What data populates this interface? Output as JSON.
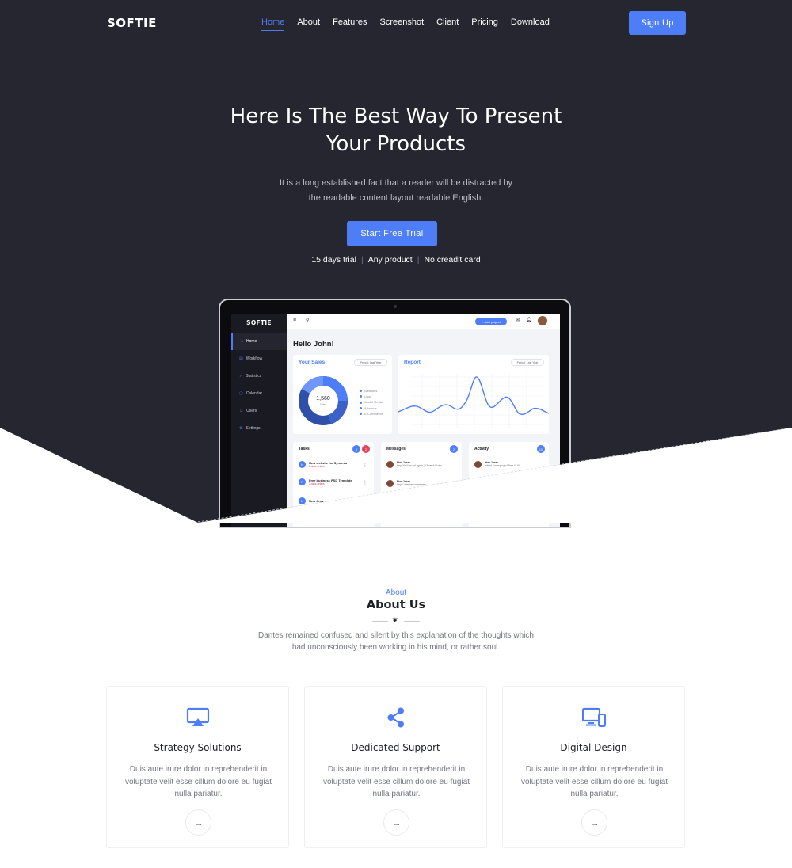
{
  "colors": {
    "hero_bg": "#262631",
    "accent": "#4d7ef7",
    "text_dark": "#1e1f27",
    "text_muted": "#747683",
    "danger": "#e2445c"
  },
  "brand": {
    "logo": "SOFTIE"
  },
  "nav": {
    "items": [
      {
        "label": "Home",
        "active": true
      },
      {
        "label": "About"
      },
      {
        "label": "Features"
      },
      {
        "label": "Screenshot"
      },
      {
        "label": "Client"
      },
      {
        "label": "Pricing"
      },
      {
        "label": "Download"
      }
    ],
    "signup_label": "Sign Up"
  },
  "hero": {
    "title_line1": "Here Is The Best Way To Present",
    "title_line2": "Your Products",
    "desc_line1": "It is a long established fact that a reader will be distracted by",
    "desc_line2": "the readable content layout readable English.",
    "cta_label": "Start Free Trial",
    "features": [
      "15 days trial",
      "Any product",
      "No creadit card"
    ]
  },
  "dashboard": {
    "logo": "SOFTIE",
    "sidebar": [
      "Home",
      "Workflow",
      "Statistics",
      "Calendar",
      "Users",
      "Settings"
    ],
    "add_project": "+ Add project",
    "greeting": "Hello John!",
    "sales": {
      "title": "Your Sales",
      "period": "Period: Last Year",
      "total": "1,560",
      "total_label": "Sales",
      "legend": [
        "Websites",
        "Logo",
        "Social Media",
        "Adwords",
        "E-Commerce"
      ]
    },
    "report": {
      "title": "Report",
      "period": "Period: Last Year"
    },
    "tasks": {
      "title": "Tasks",
      "badge1": "6",
      "badge2": "2",
      "items": [
        {
          "initial": "N",
          "title": "New website for Symu.co",
          "due": "5 days delays"
        },
        {
          "initial": "F",
          "title": "Free business PSD Template",
          "due": "2 days delays"
        },
        {
          "initial": "N",
          "title": "New Jess..."
        }
      ]
    },
    "messages": {
      "title": "Messages",
      "badge": "2",
      "items": [
        {
          "name": "Nina Jones",
          "text": "Hey! You! I'm not again :) I'll send it later"
        },
        {
          "name": "Nina Jones",
          "text": "Hey! I attached some new..."
        }
      ]
    },
    "activity": {
      "title": "Activity",
      "badge": "10",
      "items": [
        {
          "name": "Nina Jones",
          "text": "added a new project Free UI Kit"
        }
      ]
    }
  },
  "about": {
    "eyebrow": "About",
    "title": "About Us",
    "desc_line1": "Dantes remained confused and silent by this explanation of the thoughts which",
    "desc_line2": "had unconsciously been working in his mind, or rather soul.",
    "services": [
      {
        "icon": "airplay-icon",
        "title": "Strategy Solutions",
        "line1": "Duis aute irure dolor in reprehenderit in",
        "line2": "voluptate velit esse cillum dolore eu fugiat",
        "line3": "nulla pariatur."
      },
      {
        "icon": "share-icon",
        "title": "Dedicated Support",
        "line1": "Duis aute irure dolor in reprehenderit in",
        "line2": "voluptate velit esse cillum dolore eu fugiat",
        "line3": "nulla pariatur."
      },
      {
        "icon": "devices-icon",
        "title": "Digital Design",
        "line1": "Duis aute irure dolor in reprehenderit in",
        "line2": "voluptate velit esse cillum dolore eu fugiat",
        "line3": "nulla pariatur."
      }
    ]
  }
}
